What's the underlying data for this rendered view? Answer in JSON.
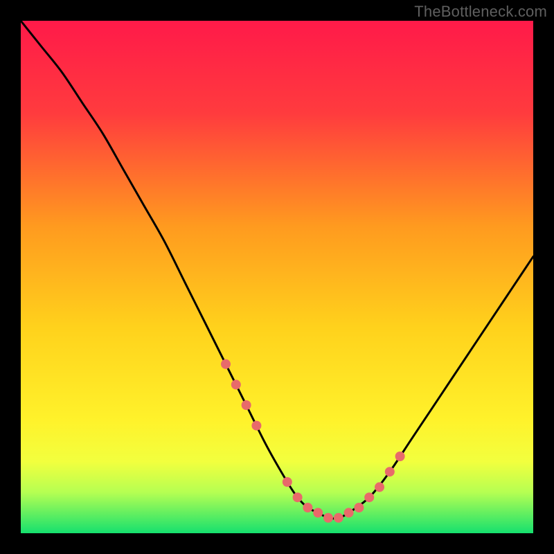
{
  "watermark": "TheBottleneck.com",
  "chart_data": {
    "type": "line",
    "title": "",
    "xlabel": "",
    "ylabel": "",
    "xlim": [
      0,
      100
    ],
    "ylim": [
      0,
      100
    ],
    "gradient_stops": [
      {
        "offset": 0,
        "color": "#ff1a49"
      },
      {
        "offset": 18,
        "color": "#ff3b3e"
      },
      {
        "offset": 40,
        "color": "#ff9a1f"
      },
      {
        "offset": 60,
        "color": "#ffd21c"
      },
      {
        "offset": 78,
        "color": "#fff22b"
      },
      {
        "offset": 86,
        "color": "#f2ff3e"
      },
      {
        "offset": 92,
        "color": "#b6ff52"
      },
      {
        "offset": 100,
        "color": "#15e06e"
      }
    ],
    "series": [
      {
        "name": "bottleneck-curve",
        "x": [
          0,
          4,
          8,
          12,
          16,
          20,
          24,
          28,
          32,
          36,
          40,
          44,
          48,
          52,
          54,
          56,
          58,
          60,
          62,
          64,
          68,
          72,
          76,
          80,
          84,
          88,
          92,
          96,
          100
        ],
        "y": [
          100,
          95,
          90,
          84,
          78,
          71,
          64,
          57,
          49,
          41,
          33,
          25,
          17,
          10,
          7,
          5,
          4,
          3,
          3,
          4,
          7,
          12,
          18,
          24,
          30,
          36,
          42,
          48,
          54
        ]
      }
    ],
    "markers": {
      "name": "highlight-points",
      "color": "#e86a6a",
      "radius": 7,
      "x": [
        40,
        42,
        44,
        46,
        52,
        54,
        56,
        58,
        60,
        62,
        64,
        66,
        68,
        70,
        72,
        74
      ],
      "y": [
        33,
        29,
        25,
        21,
        10,
        7,
        5,
        4,
        3,
        3,
        4,
        5,
        7,
        9,
        12,
        15
      ]
    }
  }
}
